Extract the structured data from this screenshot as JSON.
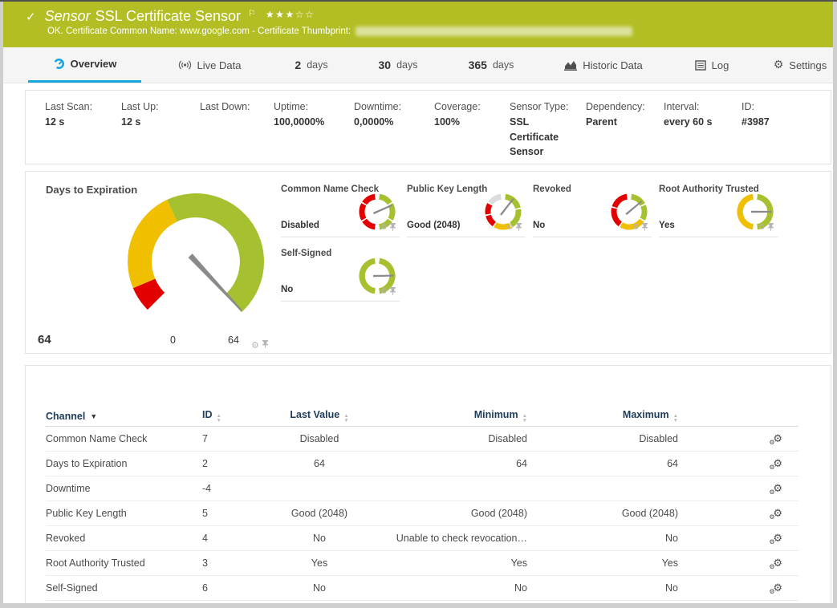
{
  "header": {
    "status_icon": "check",
    "kind": "Sensor",
    "title": "SSL Certificate Sensor",
    "flag_icon": "flag",
    "rating_filled": 3,
    "rating_empty": 2,
    "status_line": "OK. Certificate Common Name: www.google.com - Certificate Thumbprint:",
    "thumbprint_redacted": true,
    "bg_color": "#b2be23"
  },
  "tabs": [
    {
      "label": "Overview",
      "icon": "gauge",
      "active": true
    },
    {
      "label": "Live Data",
      "icon": "broadcast",
      "active": false
    },
    {
      "number": "2",
      "unit": "days",
      "active": false
    },
    {
      "number": "30",
      "unit": "days",
      "active": false
    },
    {
      "number": "365",
      "unit": "days",
      "active": false
    },
    {
      "label": "Historic Data",
      "icon": "chart",
      "active": false
    },
    {
      "label": "Log",
      "icon": "log",
      "active": false
    },
    {
      "label": "Settings",
      "icon": "gear",
      "active": false
    }
  ],
  "info_bar": [
    {
      "label": "Last Scan:",
      "value": "12 s"
    },
    {
      "label": "Last Up:",
      "value": "12 s"
    },
    {
      "label": "Last Down:",
      "value": ""
    },
    {
      "label": "Uptime:",
      "value": "100,0000%"
    },
    {
      "label": "Downtime:",
      "value": "0,0000%"
    },
    {
      "label": "Coverage:",
      "value": "100%"
    },
    {
      "label": "Sensor Type:",
      "value": "SSL Certificate Sensor"
    },
    {
      "label": "Dependency:",
      "value": "Parent"
    },
    {
      "label": "Interval:",
      "value": "every 60 s"
    },
    {
      "label": "ID:",
      "value": "#3987"
    }
  ],
  "gauges": {
    "colors": {
      "green": "#a6c12f",
      "yellow": "#f0bf00",
      "red": "#e30000",
      "gray": "#dcdcdc",
      "needle": "#8a8a8a"
    },
    "main": {
      "title": "Days to Expiration",
      "value": "64",
      "scale_min": "0",
      "scale_max": "64",
      "needle_angle": 137,
      "segments": [
        {
          "from": -135,
          "to": -113,
          "color": "#e30000"
        },
        {
          "from": -113,
          "to": -25,
          "color": "#f0bf00"
        },
        {
          "from": -25,
          "to": 138,
          "color": "#a6c12f"
        }
      ]
    },
    "small": [
      {
        "title": "Common Name Check",
        "value": "Disabled",
        "needle_angle": 66,
        "segments": [
          {
            "from": 8,
            "to": 56,
            "color": "#a6c12f"
          },
          {
            "from": 61,
            "to": 119,
            "color": "#a6c12f"
          },
          {
            "from": 124,
            "to": 172,
            "color": "#a6c12f"
          },
          {
            "from": 188,
            "to": 236,
            "color": "#e30000"
          },
          {
            "from": 241,
            "to": 299,
            "color": "#e30000"
          },
          {
            "from": 304,
            "to": 352,
            "color": "#e30000"
          }
        ]
      },
      {
        "title": "Public Key Length",
        "value": "Good (2048)",
        "needle_angle": 38,
        "segments": [
          {
            "from": 8,
            "to": 76,
            "color": "#a6c12f"
          },
          {
            "from": 81,
            "to": 148,
            "color": "#a6c12f"
          },
          {
            "from": 153,
            "to": 211,
            "color": "#f0bf00"
          },
          {
            "from": 216,
            "to": 256,
            "color": "#e30000"
          },
          {
            "from": 261,
            "to": 299,
            "color": "#e30000"
          },
          {
            "from": 304,
            "to": 352,
            "color": "#dcdcdc"
          }
        ]
      },
      {
        "title": "Revoked",
        "value": "No",
        "needle_angle": 50,
        "segments": [
          {
            "from": 8,
            "to": 62,
            "color": "#a6c12f"
          },
          {
            "from": 67,
            "to": 119,
            "color": "#a6c12f"
          },
          {
            "from": 124,
            "to": 211,
            "color": "#f0bf00"
          },
          {
            "from": 216,
            "to": 283,
            "color": "#e30000"
          },
          {
            "from": 288,
            "to": 352,
            "color": "#e30000"
          }
        ]
      },
      {
        "title": "Root Authority Trusted",
        "value": "Yes",
        "needle_angle": 90,
        "segments": [
          {
            "from": 8,
            "to": 172,
            "color": "#a6c12f"
          },
          {
            "from": 188,
            "to": 352,
            "color": "#f0bf00"
          }
        ]
      },
      {
        "title": "Self-Signed",
        "value": "No",
        "needle_angle": 89,
        "segments": [
          {
            "from": 8,
            "to": 172,
            "color": "#a6c12f"
          },
          {
            "from": 188,
            "to": 352,
            "color": "#a6c12f"
          }
        ]
      }
    ]
  },
  "channel_table": {
    "columns": [
      {
        "label": "Channel",
        "sort": "desc",
        "align": "left"
      },
      {
        "label": "ID",
        "sort": "both",
        "align": "left"
      },
      {
        "label": "Last Value",
        "sort": "both",
        "align": "center"
      },
      {
        "label": "Minimum",
        "sort": "both",
        "align": "right"
      },
      {
        "label": "Maximum",
        "sort": "both",
        "align": "right"
      }
    ],
    "rows": [
      {
        "cells": [
          "Common Name Check",
          "7",
          "Disabled",
          "Disabled",
          "Disabled"
        ]
      },
      {
        "cells": [
          "Days to Expiration",
          "2",
          "64",
          "64",
          "64"
        ]
      },
      {
        "cells": [
          "Downtime",
          "-4",
          "",
          "",
          ""
        ]
      },
      {
        "cells": [
          "Public Key Length",
          "5",
          "Good (2048)",
          "Good (2048)",
          "Good (2048)"
        ]
      },
      {
        "cells": [
          "Revoked",
          "4",
          "No",
          "Unable to check revocation…",
          "No"
        ]
      },
      {
        "cells": [
          "Root Authority Trusted",
          "3",
          "Yes",
          "Yes",
          "Yes"
        ]
      },
      {
        "cells": [
          "Self-Signed",
          "6",
          "No",
          "No",
          "No"
        ]
      }
    ],
    "row_action_icon": "gear"
  },
  "colors": {
    "accent_blue": "#17a7e0",
    "header_green": "#b2be23",
    "table_header_text": "#1d3c5a"
  }
}
